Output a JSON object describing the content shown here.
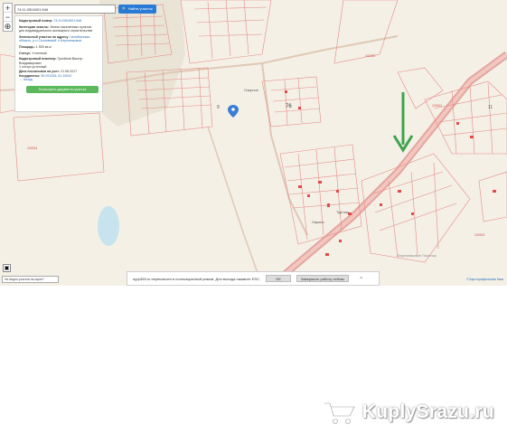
{
  "map": {
    "zoom_in": "+",
    "zoom_out": "−",
    "locate": "⊕",
    "search": {
      "value": "74:11:0504001:546",
      "button": "Найти участок"
    },
    "labels": {
      "number_76": "76",
      "village_1": "Озерное",
      "village_2": "Ларино",
      "village_3": "Тургояк",
      "area_top": "240303",
      "area_left": "240334",
      "area_right_1": "240301",
      "area_right_2": "240303",
      "area_bottom": "Березняковое Поселок",
      "num_9": "9",
      "num_11": "11"
    },
    "layers_icon": "layers-icon",
    "bottom_input": "Не видно участка на карте?",
    "attribution": "© Картографическая база",
    "accent_arrow_color": "#3fa34d"
  },
  "info_panel": {
    "cadastral_label": "Кадастровый номер:",
    "cadastral_value": "74:11:0504001:546",
    "category_label": "Категория земель:",
    "category_value": "Земли населенных пунктов",
    "use_value": "для индивидуального жилищного строительства",
    "address_label": "Земельный участок по адресу:",
    "address_value": "Челябинская область, р-н Сосновский, п Березняковое",
    "area_label": "Площадь:",
    "area_value": "1 500 кв.м",
    "status_label": "Статус:",
    "status_value": "Учтенный",
    "engineer_label": "Кадастровый инженер:",
    "engineer_value": "Гусейнов Виктор Владимирович",
    "status2": "1 статус учтенный",
    "date_label": "Дата постановки на учет:",
    "date_value": "21.08.2017",
    "coords_label": "Координаты:",
    "coords_value": "55.091335, 61.33912",
    "back": "Назад",
    "order_button": "Посмотреть документы участка"
  },
  "notice": {
    "text": "egrp365.ru переключен в полноэкранный режим. Для выхода нажмите ESC.",
    "ok": "OK",
    "close": "Завершить работу сейчас",
    "dismiss": "×"
  },
  "watermark": {
    "text": "KuplуSrazu.ru",
    "brand_color": "#ffffff"
  }
}
